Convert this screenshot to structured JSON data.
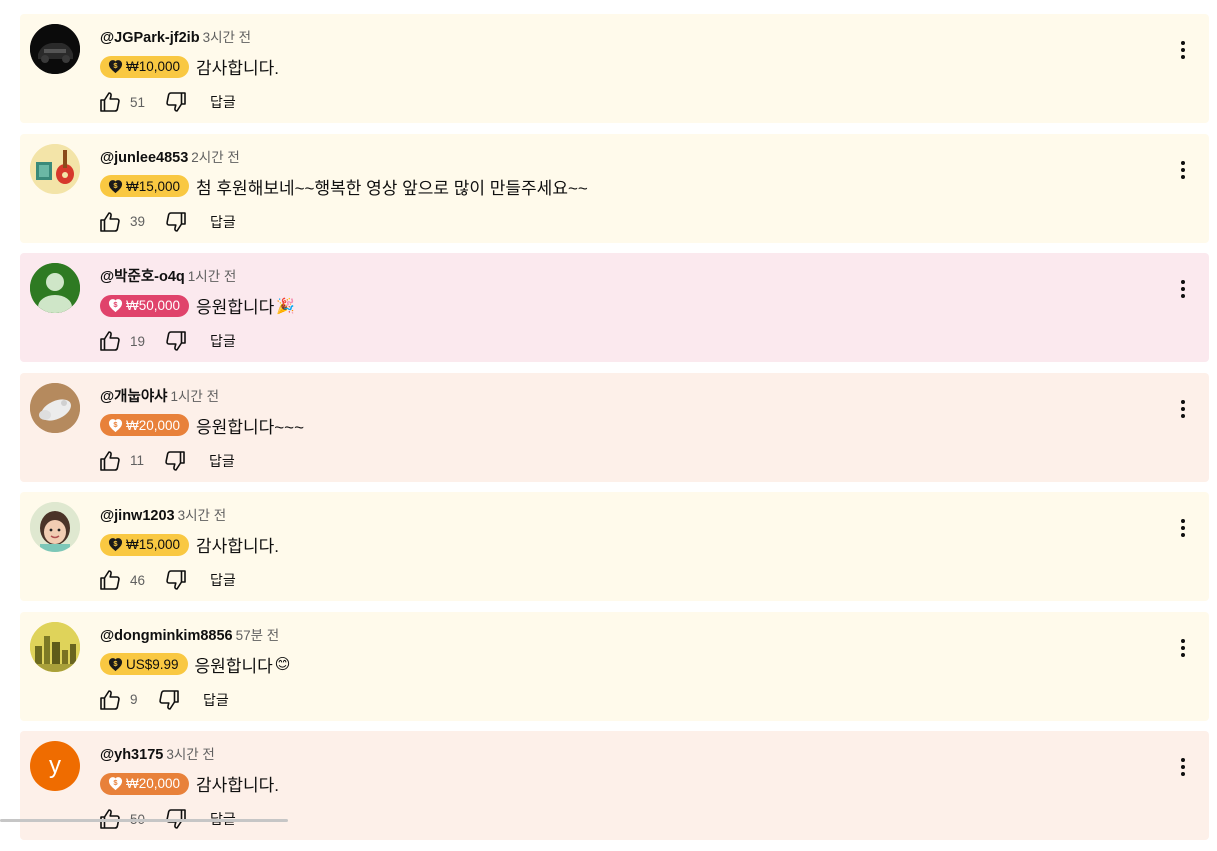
{
  "comments": [
    {
      "author": "@JGPark-jf2ib",
      "time": "3시간 전",
      "amount": "₩10,000",
      "text": "감사합니다.",
      "emoji": "",
      "likes": "51",
      "reply": "답글",
      "card_bg": "#fffaeb",
      "chip_bg": "#f9c842",
      "chip_fg": "#0f0f0f",
      "coin": "#1a1a1a",
      "coin_mark": "#f9c842",
      "avatar": "car",
      "avatar_bg": "#111111"
    },
    {
      "author": "@junlee4853",
      "time": "2시간 전",
      "amount": "₩15,000",
      "text": "첨 후원해보네~~행복한 영상 앞으로 많이 만들주세요~~",
      "emoji": "",
      "likes": "39",
      "reply": "답글",
      "card_bg": "#fffaeb",
      "chip_bg": "#f9c842",
      "chip_fg": "#0f0f0f",
      "coin": "#1a1a1a",
      "coin_mark": "#f9c842",
      "avatar": "guitar",
      "avatar_bg": "#f5e6b0"
    },
    {
      "author": "@박준호-o4q",
      "time": "1시간 전",
      "amount": "₩50,000",
      "text": "응원합니다",
      "emoji": "🎉",
      "likes": "19",
      "reply": "답글",
      "card_bg": "#fbe9ee",
      "chip_bg": "#e0436b",
      "chip_fg": "#ffffff",
      "coin": "#ffffff",
      "coin_mark": "#e0436b",
      "avatar": "default",
      "avatar_bg": "#2e7a22"
    },
    {
      "author": "@개눕야샤",
      "time": "1시간 전",
      "amount": "₩20,000",
      "text": "응원합니다~~~",
      "emoji": "",
      "likes": "11",
      "reply": "답글",
      "card_bg": "#fdf0e9",
      "chip_bg": "#e8813a",
      "chip_fg": "#ffffff",
      "coin": "#ffffff",
      "coin_mark": "#e8813a",
      "avatar": "dog",
      "avatar_bg": "#b58a5e"
    },
    {
      "author": "@jinw1203",
      "time": "3시간 전",
      "amount": "₩15,000",
      "text": "감사합니다.",
      "emoji": "",
      "likes": "46",
      "reply": "답글",
      "card_bg": "#fffaeb",
      "chip_bg": "#f9c842",
      "chip_fg": "#0f0f0f",
      "coin": "#1a1a1a",
      "coin_mark": "#f9c842",
      "avatar": "child",
      "avatar_bg": "#dfe8d0"
    },
    {
      "author": "@dongminkim8856",
      "time": "57분 전",
      "amount": "US$9.99",
      "text": "응원합니다",
      "emoji": "😊",
      "likes": "9",
      "reply": "답글",
      "card_bg": "#fffaeb",
      "chip_bg": "#f9c842",
      "chip_fg": "#0f0f0f",
      "coin": "#1a1a1a",
      "coin_mark": "#f9c842",
      "avatar": "city",
      "avatar_bg": "#d7c84a"
    },
    {
      "author": "@yh3175",
      "time": "3시간 전",
      "amount": "₩20,000",
      "text": "감사합니다.",
      "emoji": "",
      "likes": "50",
      "reply": "답글",
      "card_bg": "#fdf0e9",
      "chip_bg": "#e8813a",
      "chip_fg": "#ffffff",
      "coin": "#ffffff",
      "coin_mark": "#e8813a",
      "avatar": "letter",
      "avatar_letter": "y",
      "avatar_bg": "#ef6c00"
    }
  ],
  "icons": {
    "like": "thumb-up-icon",
    "dislike": "thumb-down-icon",
    "menu": "more-vert-icon",
    "coin": "super-thanks-icon"
  }
}
